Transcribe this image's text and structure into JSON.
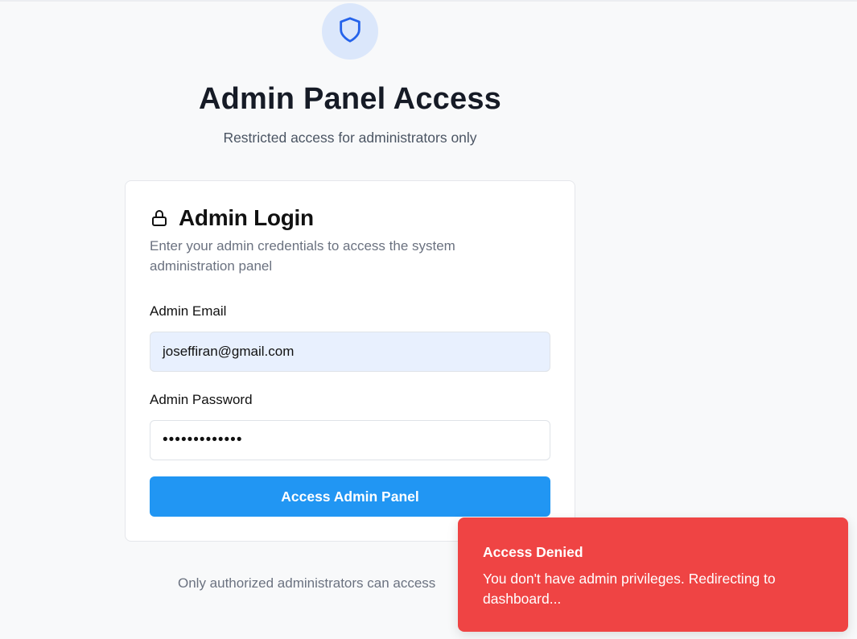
{
  "header": {
    "icon": "shield-icon",
    "title": "Admin Panel Access",
    "subtitle": "Restricted access for administrators only"
  },
  "login_card": {
    "icon": "lock-icon",
    "title": "Admin Login",
    "description": "Enter your admin credentials to access the system administration panel",
    "email_label": "Admin Email",
    "email_value": "joseffiran@gmail.com",
    "password_label": "Admin Password",
    "password_value": "•••••••••••••",
    "submit_label": "Access Admin Panel"
  },
  "footer": {
    "note": "Only authorized administrators can access"
  },
  "toast": {
    "title": "Access Denied",
    "message": "You don't have admin privileges. Redirecting to dashboard...",
    "color": "#ef4444"
  },
  "colors": {
    "accent": "#2196f3",
    "shield_bg": "#dbe7fb",
    "shield_stroke": "#2563eb",
    "page_bg": "#f8f9fa"
  }
}
